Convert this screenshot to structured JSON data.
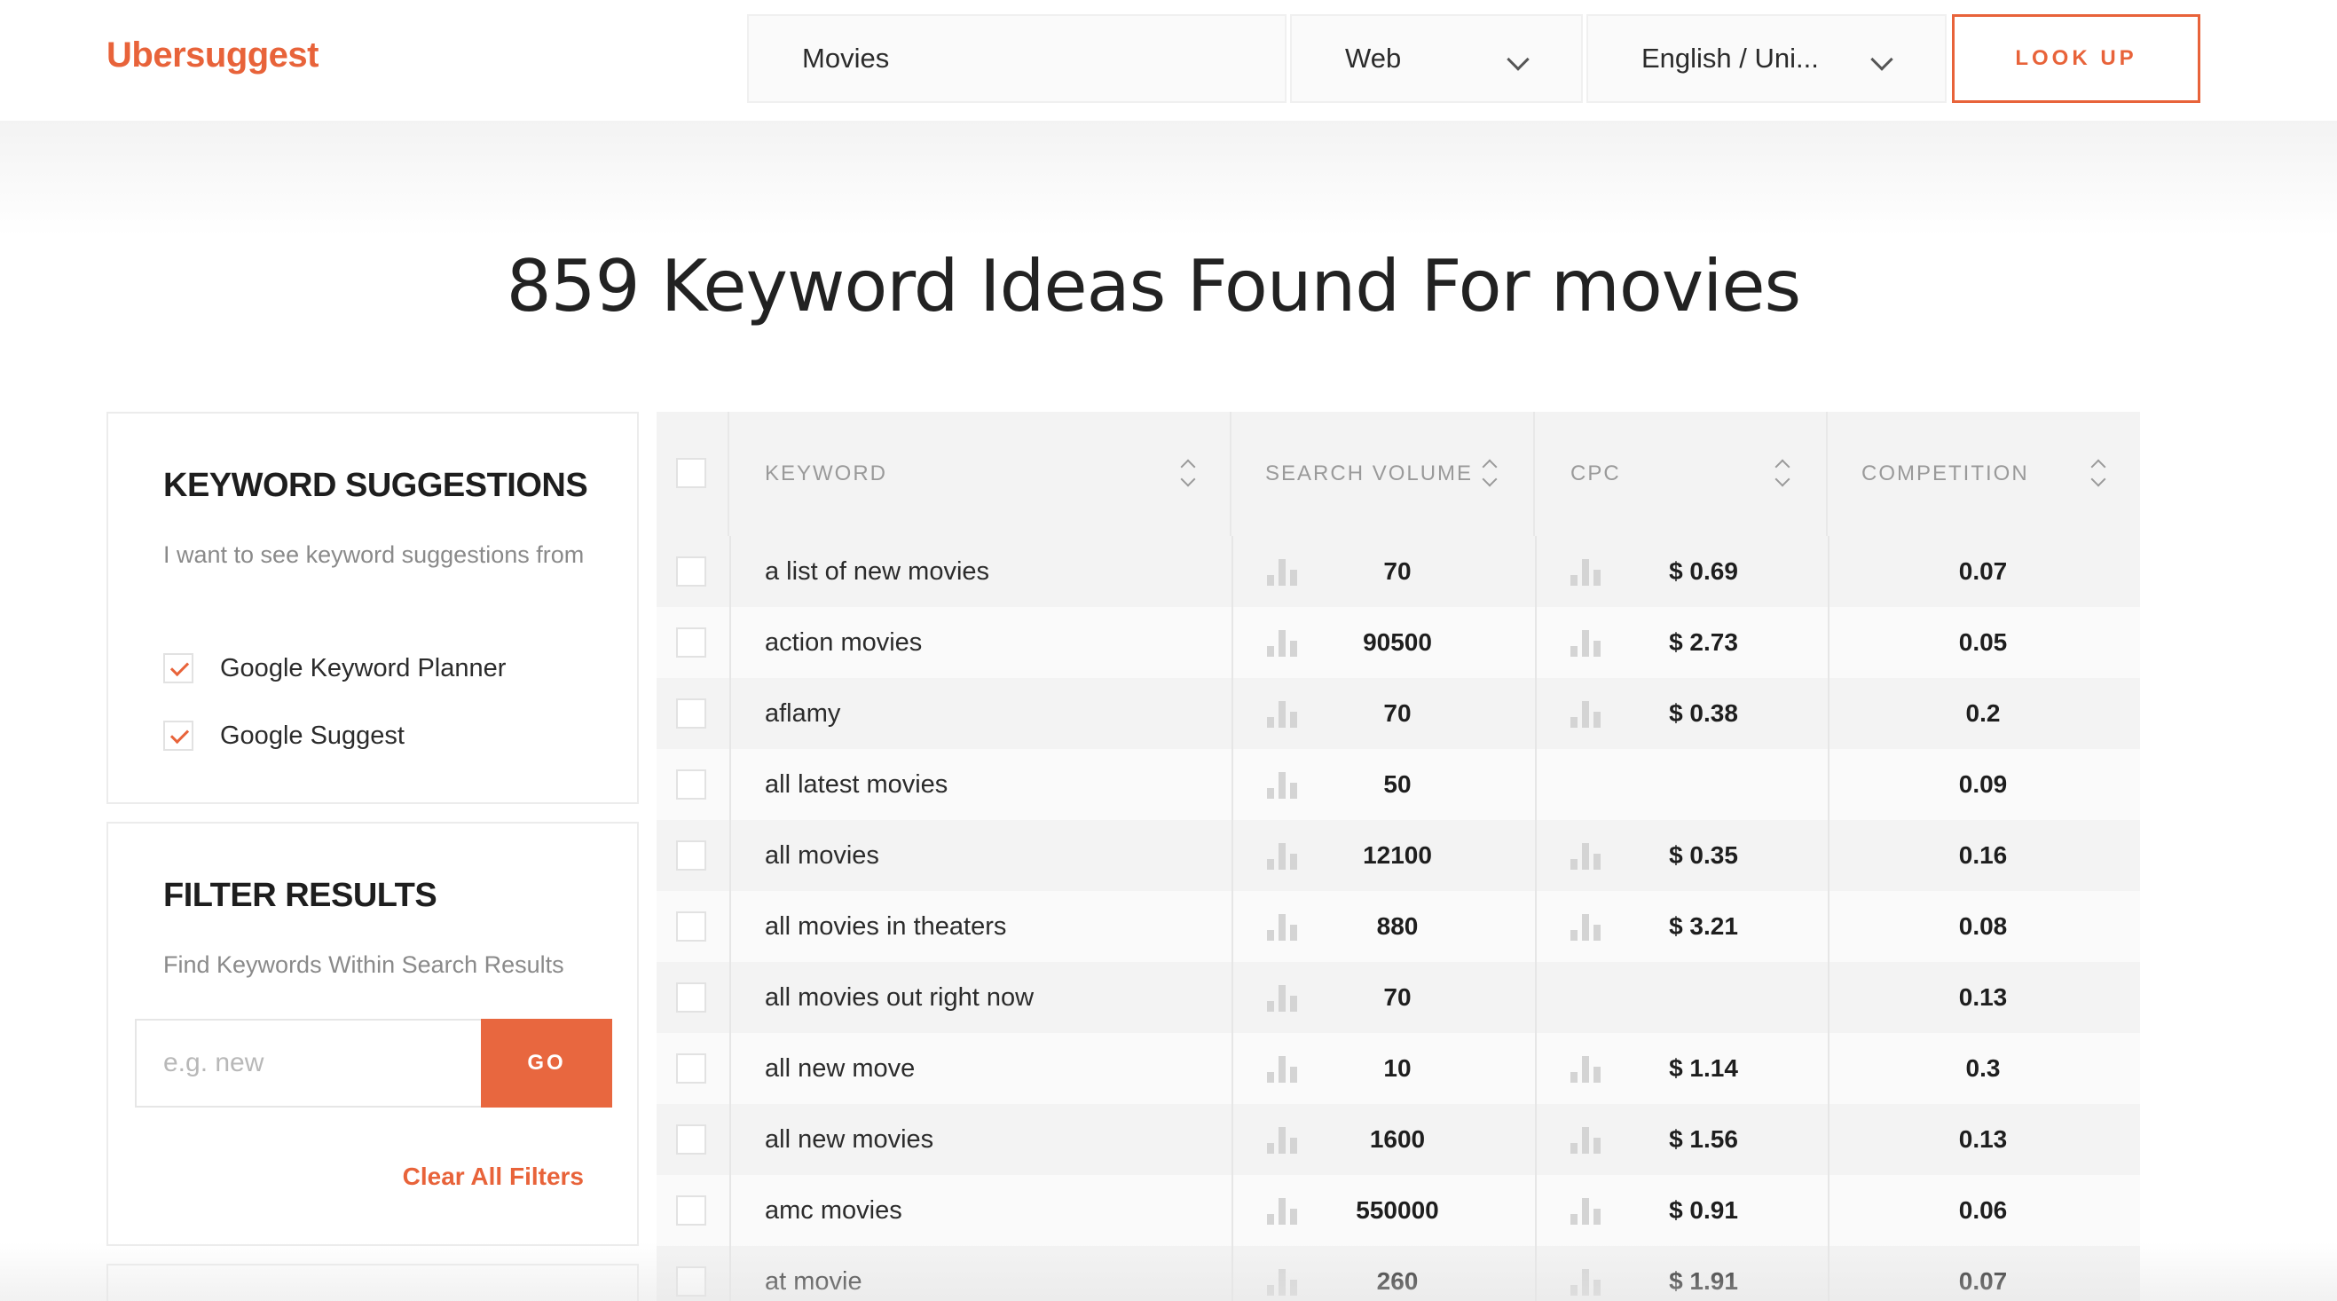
{
  "header": {
    "logo": "Ubersuggest",
    "search_value": "Movies",
    "source_value": "Web",
    "language_value": "English / Uni...",
    "lookup_label": "LOOK UP"
  },
  "page_title": "859 Keyword Ideas Found For movies",
  "keyword_suggestions": {
    "title": "KEYWORD SUGGESTIONS",
    "description": "I want to see keyword suggestions from",
    "options": [
      {
        "label": "Google Keyword Planner",
        "checked": true
      },
      {
        "label": "Google Suggest",
        "checked": true
      }
    ]
  },
  "filter_results": {
    "title": "FILTER RESULTS",
    "description": "Find Keywords Within Search Results",
    "placeholder": "e.g. new",
    "go_label": "GO",
    "clear_label": "Clear All Filters"
  },
  "table": {
    "columns": [
      "KEYWORD",
      "SEARCH VOLUME",
      "CPC",
      "COMPETITION"
    ],
    "rows": [
      {
        "keyword": "a list of new movies",
        "volume": "70",
        "cpc": "$ 0.69",
        "competition": "0.07"
      },
      {
        "keyword": "action movies",
        "volume": "90500",
        "cpc": "$ 2.73",
        "competition": "0.05"
      },
      {
        "keyword": "aflamy",
        "volume": "70",
        "cpc": "$ 0.38",
        "competition": "0.2"
      },
      {
        "keyword": "all latest movies",
        "volume": "50",
        "cpc": "",
        "competition": "0.09"
      },
      {
        "keyword": "all movies",
        "volume": "12100",
        "cpc": "$ 0.35",
        "competition": "0.16"
      },
      {
        "keyword": "all movies in theaters",
        "volume": "880",
        "cpc": "$ 3.21",
        "competition": "0.08"
      },
      {
        "keyword": "all movies out right now",
        "volume": "70",
        "cpc": "",
        "competition": "0.13"
      },
      {
        "keyword": "all new move",
        "volume": "10",
        "cpc": "$ 1.14",
        "competition": "0.3"
      },
      {
        "keyword": "all new movies",
        "volume": "1600",
        "cpc": "$ 1.56",
        "competition": "0.13"
      },
      {
        "keyword": "amc movies",
        "volume": "550000",
        "cpc": "$ 0.91",
        "competition": "0.06"
      },
      {
        "keyword": "at movie",
        "volume": "260",
        "cpc": "$ 1.91",
        "competition": "0.07"
      }
    ]
  },
  "colors": {
    "accent": "#e8633a",
    "row_alt": "#f3f3f3",
    "bar_icon": "#d4d4d4"
  }
}
